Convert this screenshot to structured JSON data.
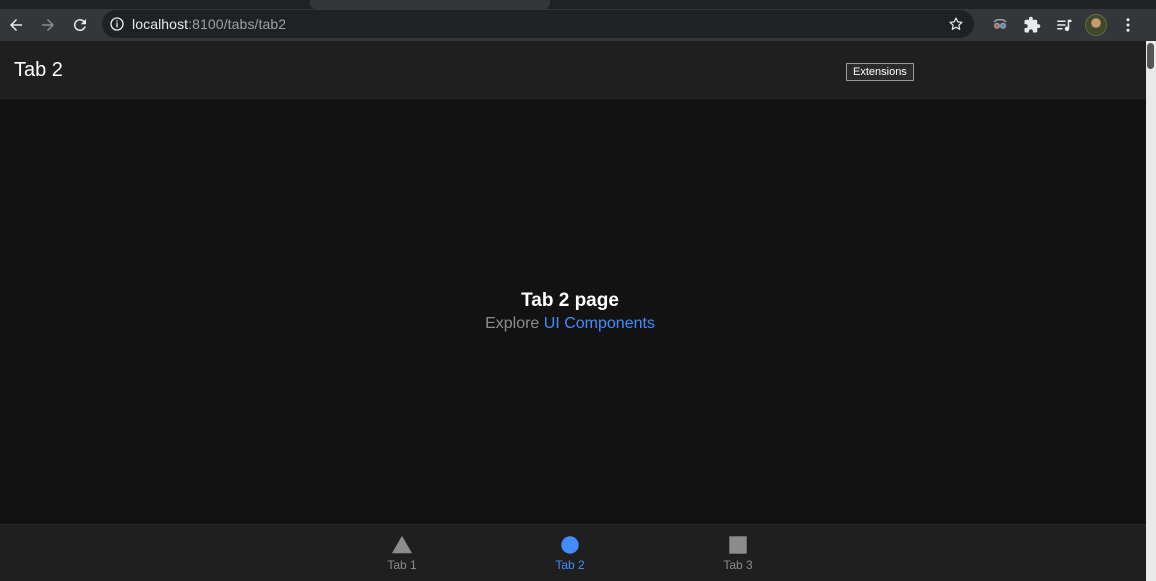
{
  "browser": {
    "url_host": "localhost",
    "url_path": ":8100/tabs/tab2",
    "toolbar_icons": [
      "extension-icon",
      "puzzle-icon",
      "media-queue-icon",
      "avatar",
      "kebab-menu-icon"
    ]
  },
  "header": {
    "title": "Tab 2",
    "tooltip": "Extensions"
  },
  "main": {
    "heading": "Tab 2 page",
    "explore_prefix": "Explore",
    "explore_link": "UI Components"
  },
  "tabs": [
    {
      "label": "Tab 1",
      "icon": "triangle-icon",
      "active": false
    },
    {
      "label": "Tab 2",
      "icon": "ellipse-icon",
      "active": true
    },
    {
      "label": "Tab 3",
      "icon": "square-icon",
      "active": false
    }
  ],
  "colors": {
    "accent": "#428cff",
    "background": "#121212",
    "toolbar": "#1f1f1f"
  }
}
